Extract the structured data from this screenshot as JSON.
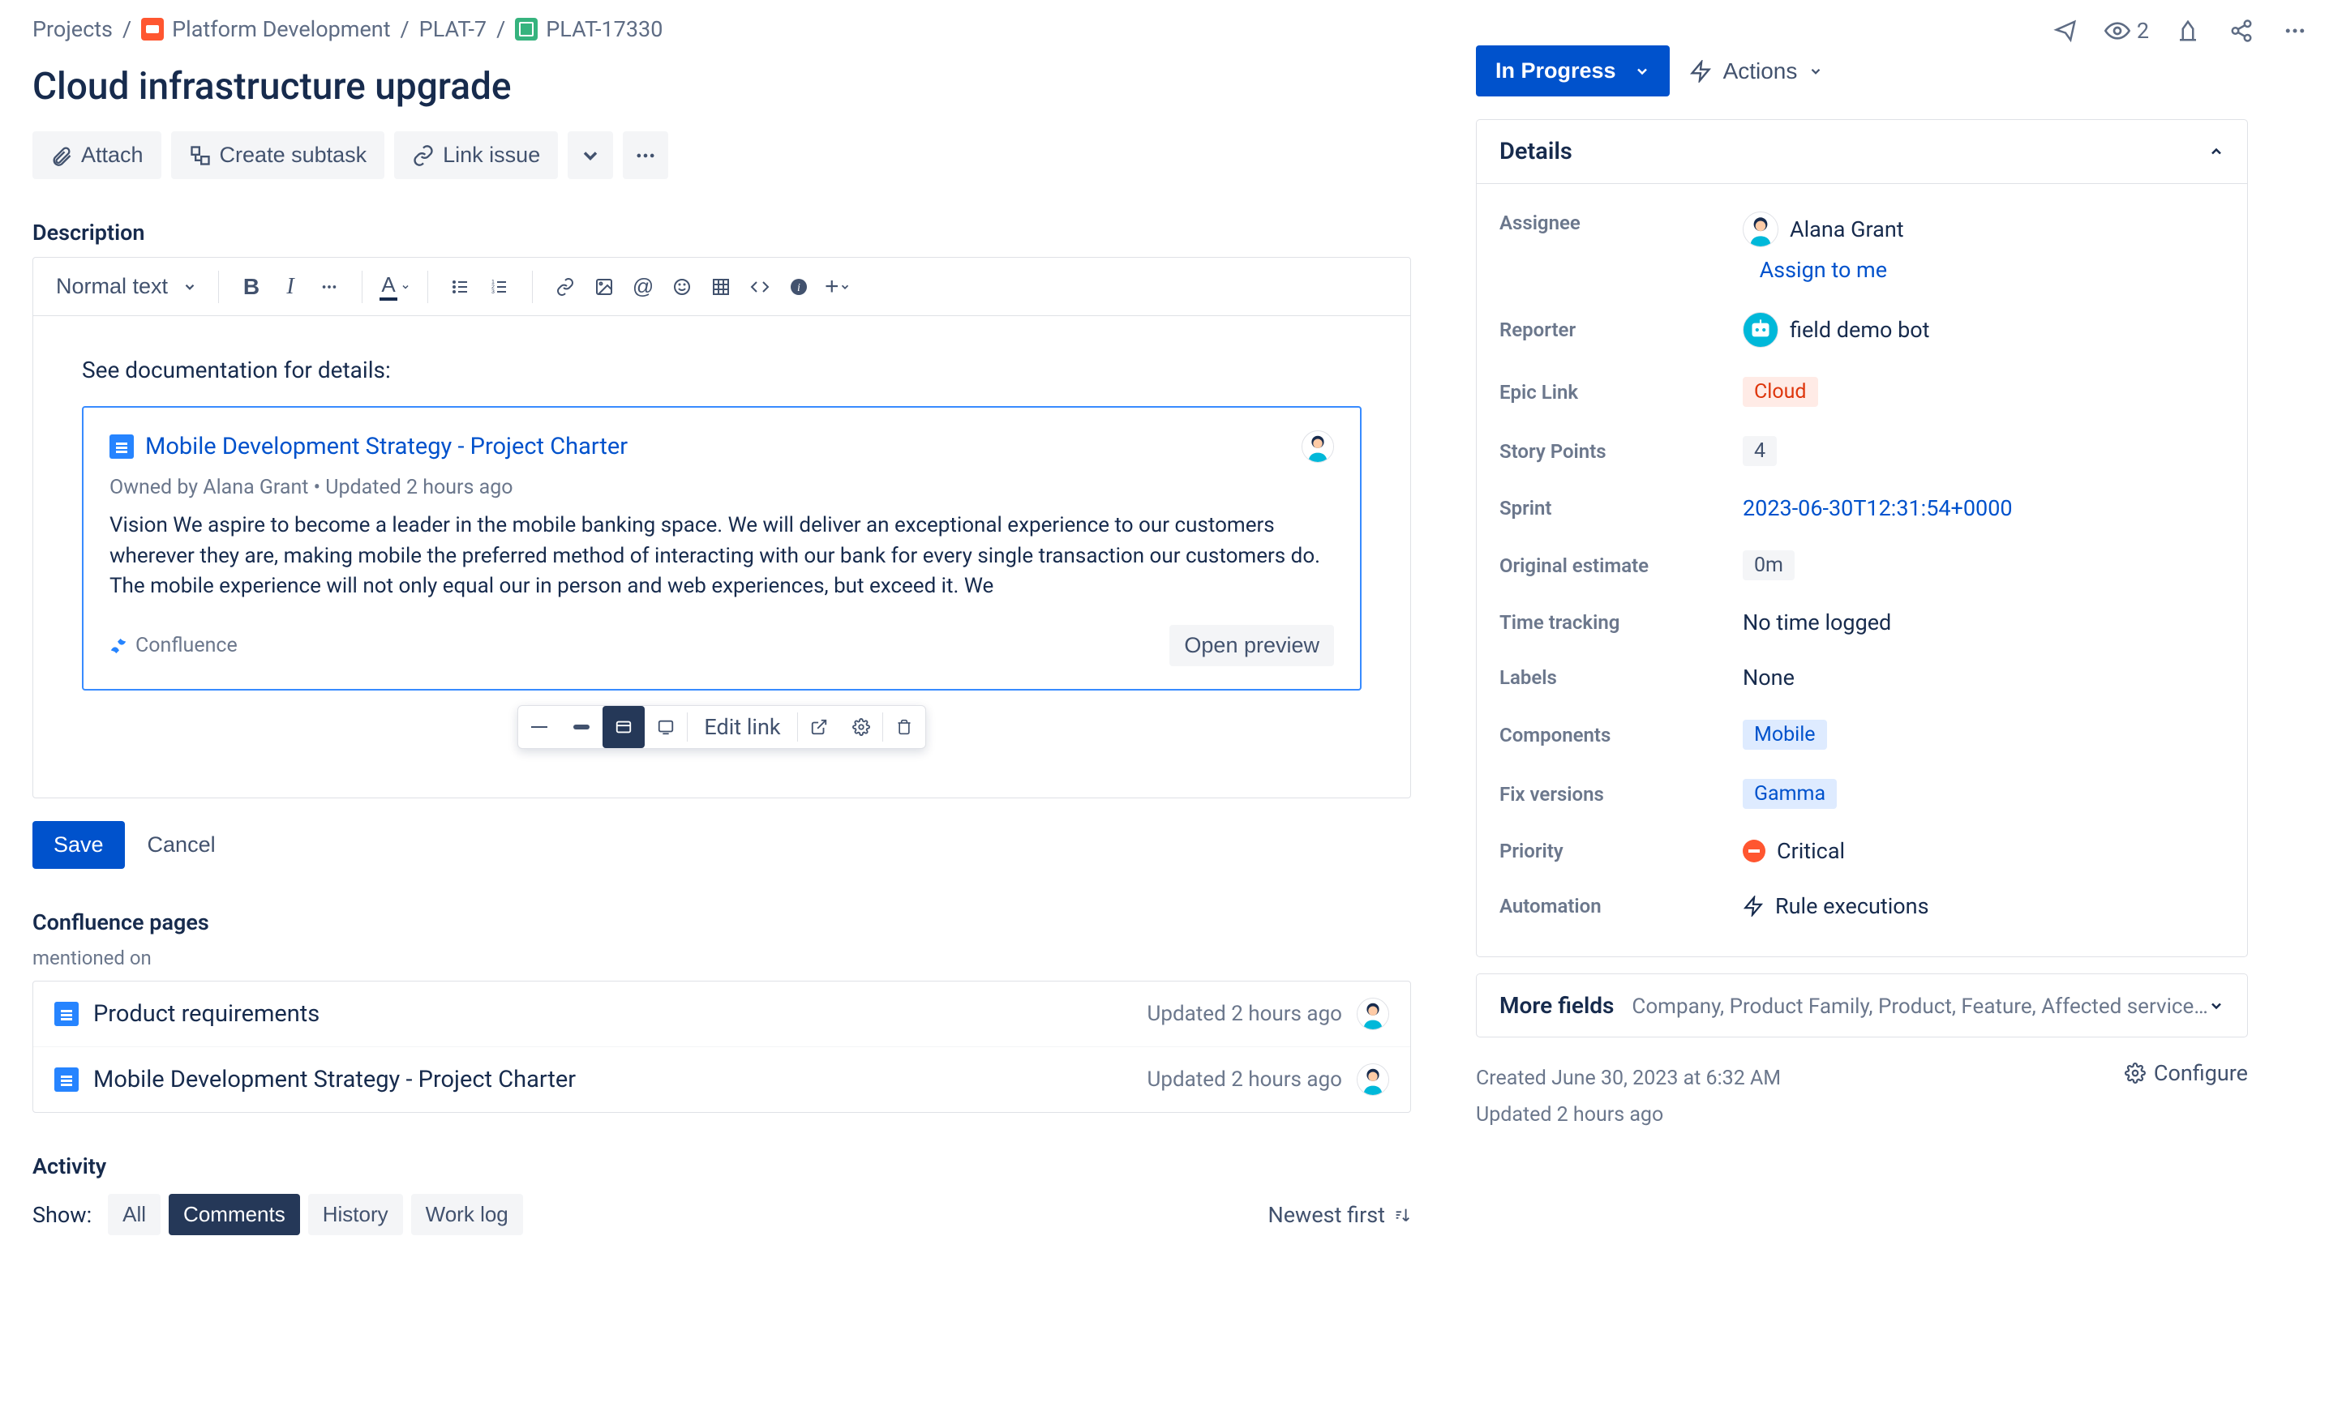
{
  "breadcrumb": {
    "projects": "Projects",
    "project": "Platform Development",
    "epic": "PLAT-7",
    "issue": "PLAT-17330"
  },
  "watchers": "2",
  "title": "Cloud infrastructure upgrade",
  "actionBar": {
    "attach": "Attach",
    "createSubtask": "Create subtask",
    "linkIssue": "Link issue"
  },
  "description": {
    "heading": "Description",
    "styleDropdown": "Normal text",
    "bodyText": "See documentation for details:",
    "smartLink": {
      "title": "Mobile Development Strategy - Project Charter",
      "meta": "Owned by Alana Grant   •   Updated 2 hours ago",
      "snippet": "Vision We aspire to become a leader in the mobile banking space. We will deliver an exceptional experience to our customers wherever they are, making mobile the preferred method of interacting with our bank for every single transaction our customers do. The mobile experience will not only equal our in person and web experiences, but exceed it. We",
      "source": "Confluence",
      "openPreview": "Open preview"
    },
    "linkToolbar": {
      "editLink": "Edit link"
    },
    "save": "Save",
    "cancel": "Cancel"
  },
  "confluence": {
    "heading": "Confluence pages",
    "subLabel": "mentioned on",
    "pages": [
      {
        "title": "Product requirements",
        "updated": "Updated 2 hours ago"
      },
      {
        "title": "Mobile Development Strategy - Project Charter",
        "updated": "Updated 2 hours ago"
      }
    ]
  },
  "activity": {
    "heading": "Activity",
    "showLabel": "Show:",
    "tabs": {
      "all": "All",
      "comments": "Comments",
      "history": "History",
      "worklog": "Work log"
    },
    "sort": "Newest first"
  },
  "status": {
    "value": "In Progress",
    "actions": "Actions"
  },
  "details": {
    "heading": "Details",
    "assigneeLabel": "Assignee",
    "assignee": "Alana Grant",
    "assignToMe": "Assign to me",
    "reporterLabel": "Reporter",
    "reporter": "field demo bot",
    "epicLinkLabel": "Epic Link",
    "epicLink": "Cloud",
    "storyPointsLabel": "Story Points",
    "storyPoints": "4",
    "sprintLabel": "Sprint",
    "sprint": "2023-06-30T12:31:54+0000",
    "origEstLabel": "Original estimate",
    "origEst": "0m",
    "timeTrackLabel": "Time tracking",
    "timeTrack": "No time logged",
    "labelsLabel": "Labels",
    "labels": "None",
    "componentsLabel": "Components",
    "components": "Mobile",
    "fixVersionsLabel": "Fix versions",
    "fixVersions": "Gamma",
    "priorityLabel": "Priority",
    "priority": "Critical",
    "automationLabel": "Automation",
    "automation": "Rule executions"
  },
  "moreFields": {
    "title": "More fields",
    "sub": "Company, Product Family, Product, Feature, Affected service…"
  },
  "dates": {
    "created": "Created June 30, 2023 at 6:32 AM",
    "updated": "Updated 2 hours ago",
    "configure": "Configure"
  }
}
